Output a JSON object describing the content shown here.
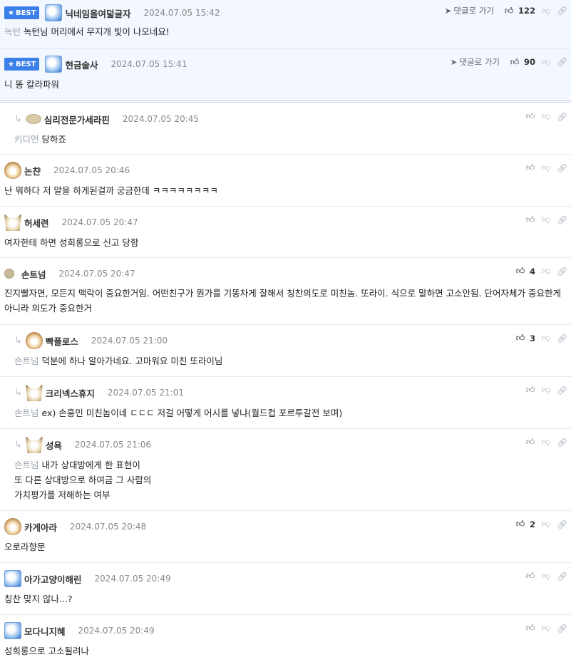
{
  "comments": [
    {
      "best": true,
      "nick": "닉네임을여덟글자",
      "date": "2024.07.05 15:42",
      "goto": "댓글로 가기",
      "likes": "122",
      "mention": "녹턴",
      "text": "녹턴님 머리에서 무지개 빛이 나오네요!"
    },
    {
      "best": true,
      "nick": "현금술사",
      "date": "2024.07.05 15:41",
      "goto": "댓글로 가기",
      "likes": "90",
      "mention": "",
      "text": "니 똥 칼라파워"
    },
    {
      "nick": "심리전문가세라핀",
      "date": "2024.07.05 20:45",
      "mention": "키디언",
      "text": "당하죠"
    },
    {
      "nick": "논챤",
      "date": "2024.07.05 20:46",
      "text": "난 뭐하다 저 말을 하게된걸까 궁금한데 ㅋㅋㅋㅋㅋㅋㅋㅋ"
    },
    {
      "nick": "허세련",
      "date": "2024.07.05 20:47",
      "text": "여자한테 하면 성희롱으로 신고 당함"
    },
    {
      "nick": "손트넘",
      "date": "2024.07.05 20:47",
      "likes": "4",
      "text": "진지빨자면, 모든지 맥락이 중요한거임. 어떤친구가 뭔가를 기똥차게 잘해서 칭찬의도로 미친놈. 또라이. 식으로 말하면 고소안됨. 단어자체가 중요한게아니라 의도가 중요한거"
    },
    {
      "nick": "빡플로스",
      "date": "2024.07.05 21:00",
      "likes": "3",
      "mention": "손트넘",
      "text": "덕분에 하나 알아가네요. 고마워요 미친 또라이님"
    },
    {
      "nick": "크리넥스휴지",
      "date": "2024.07.05 21:01",
      "mention": "손트넘",
      "text": "ex) 손흥민 미친놈이네 ㄷㄷㄷ 저걸 어떻게 어시를 넣냐(월드컵 포르투갈전 보며)"
    },
    {
      "nick": "성욕",
      "date": "2024.07.05 21:06",
      "mention": "손트넘",
      "lines": [
        "내가 상대방에게 한 표현이",
        "또 다른 상대방으로 하여금 그 사람의",
        "가치평가를 저해하는 여부"
      ]
    },
    {
      "nick": "카게아라",
      "date": "2024.07.05 20:48",
      "likes": "2",
      "text": "오로라향문"
    },
    {
      "nick": "아가고양이해린",
      "date": "2024.07.05 20:49",
      "text": "칭찬 맞지 않나...?"
    },
    {
      "nick": "모다니지혜",
      "date": "2024.07.05 20:49",
      "text": "성희롱으로 고소될려나"
    }
  ],
  "badge_label": "BEST",
  "icons": {
    "star": "star-icon",
    "goto": "arrow-icon",
    "like": "thumbs-up-icon",
    "dislike": "thumbs-down-icon",
    "link": "link-icon",
    "reply": "reply-arrow-icon"
  },
  "colors": {
    "best_bg": "#f3f7ff",
    "badge": "#3b7fe8"
  }
}
